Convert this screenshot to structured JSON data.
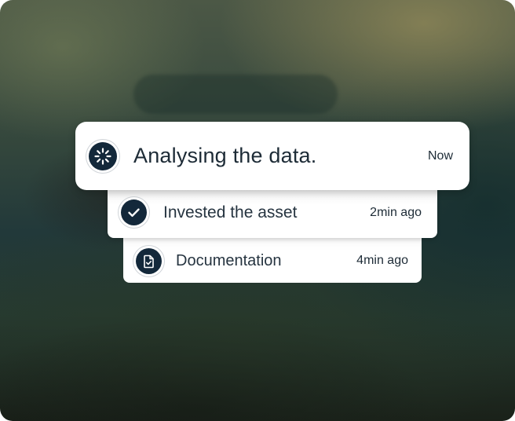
{
  "notifications": [
    {
      "title": "Analysing the data.",
      "time": "Now",
      "icon": "loading-spinner-icon"
    },
    {
      "title": "Invested the asset",
      "time": "2min ago",
      "icon": "check-icon"
    },
    {
      "title": "Documentation",
      "time": "4min ago",
      "icon": "document-check-icon"
    }
  ],
  "colors": {
    "icon_background": "#13283a",
    "card_background": "#ffffff",
    "text": "#1d2b36"
  }
}
